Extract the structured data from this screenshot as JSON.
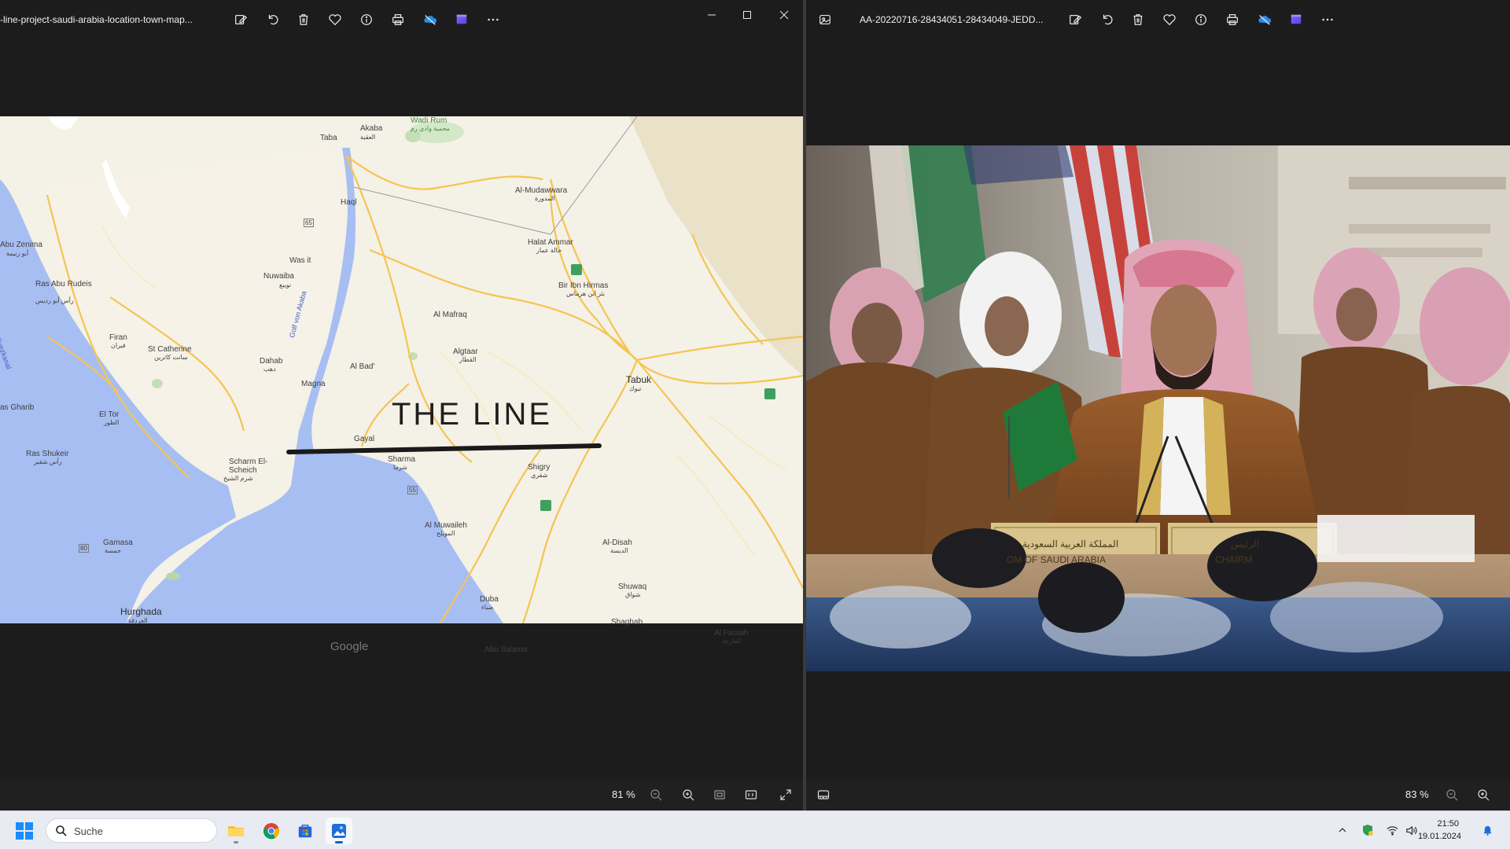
{
  "left_window": {
    "title": "-line-project-saudi-arabia-location-town-map...",
    "zoom": "81 %",
    "toolbar_icons": [
      "edit-icon",
      "rotate-icon",
      "delete-icon",
      "favorite-icon",
      "info-icon",
      "print-icon",
      "onedrive-icon",
      "clipchamp-icon",
      "more-icon"
    ],
    "window_controls": [
      "minimize-icon",
      "maximize-icon",
      "close-icon"
    ]
  },
  "right_window": {
    "title": "AA-20220716-28434051-28434049-JEDD...",
    "zoom": "83 %",
    "toolbar_icons": [
      "edit-icon",
      "rotate-icon",
      "delete-icon",
      "favorite-icon",
      "info-icon",
      "print-icon",
      "onedrive-icon",
      "clipchamp-icon",
      "more-icon"
    ]
  },
  "map": {
    "headline": "THE LINE",
    "google": "Google",
    "labels": {
      "aqaba": "Akaba",
      "aqaba_ar": "العقبة",
      "taba": "Taba",
      "wadi_rum": "Wadi Rum",
      "wadi_rum_ar": "محمية وادي رم",
      "al_mudawwara": "Al-Mudawwara",
      "al_mudawwara_ar": "المدورة",
      "haql": "Haql",
      "halat_ammar": "Halat Ammar",
      "halat_ammar_ar": "حالة عمار",
      "bir_ibn_hirmas": "Bir Ibn Hirmas",
      "bir_ibn_hirmas_ar": "بئر ابن هرماس",
      "abu_zenima": "Abu Zenima",
      "abu_zenima_ar": "أبو زنيمة",
      "ras_abu_rudeis": "Ras Abu Rudeis",
      "ras_abu_rudeis_ar": "رأس أبو رديس",
      "was_it": "Was it",
      "nuwaiba": "Nuwaiba",
      "nuwaiba_ar": "نويبع",
      "al_mafraq": "Al Mafraq",
      "firan": "Firan",
      "firan_ar": "فيران",
      "st_catherine": "St Catherine",
      "st_catherine_ar": "سانت كاترين",
      "dahab": "Dahab",
      "dahab_ar": "دهب",
      "al_bad": "Al Bad'",
      "algtaar": "Algtaar",
      "algtaar_ar": "القطار",
      "tabuk": "Tabuk",
      "tabuk_ar": "تبوك",
      "magna": "Magna",
      "gulf_aqaba": "Golf von Akaba",
      "suezkanal": "Suezkanal",
      "el_tor": "El Tor",
      "el_tor_ar": "الطور",
      "as_gharib": "as Gharib",
      "ras_shukeir": "Ras Shukeir",
      "ras_shukeir_ar": "رأس شقير",
      "gayal": "Gayal",
      "sharma": "Sharma",
      "sharma_ar": "شرما",
      "shigry": "Shigry",
      "shigry_ar": "شقري",
      "scharm": "Scharm El-Scheich",
      "scharm_ar": "شرم الشيخ",
      "al_muwaileh": "Al Muwaileh",
      "al_muwaileh_ar": "المويلح",
      "al_disah": "Al-Disah",
      "al_disah_ar": "الديسة",
      "gamasa": "Gamasa",
      "gamasa_ar": "جمسة",
      "shuwaq": "Shuwaq",
      "shuwaq_ar": "شواق",
      "hurghada": "Hurghada",
      "hurghada_ar": "الغردقة",
      "duba": "Duba",
      "duba_ar": "ضباء",
      "shaghab": "Shaghab",
      "al_faraah": "Al Faraah",
      "al_faraah_ar": "الفارعة",
      "abu_salama": "Abu Salama",
      "road_65": "65",
      "road_55": "55",
      "road_80": "80"
    }
  },
  "photo": {
    "nameplate_left_ar": "المملكة العربية السعودية",
    "nameplate_left": "OM OF SAUDI ARABIA",
    "nameplate_right_ar": "الرئيس",
    "nameplate_right": "CHAIRM"
  },
  "taskbar": {
    "search_placeholder": "Suche",
    "time": "21:50",
    "date": "19.01.2024",
    "apps": [
      "file-explorer-icon",
      "chrome-icon",
      "store-icon",
      "photos-icon"
    ]
  },
  "colors": {
    "water": "#a7bef3",
    "land": "#f4f1e6",
    "land_dark": "#e9e4d2",
    "road": "#f5c453",
    "accent": "#0067c0"
  }
}
